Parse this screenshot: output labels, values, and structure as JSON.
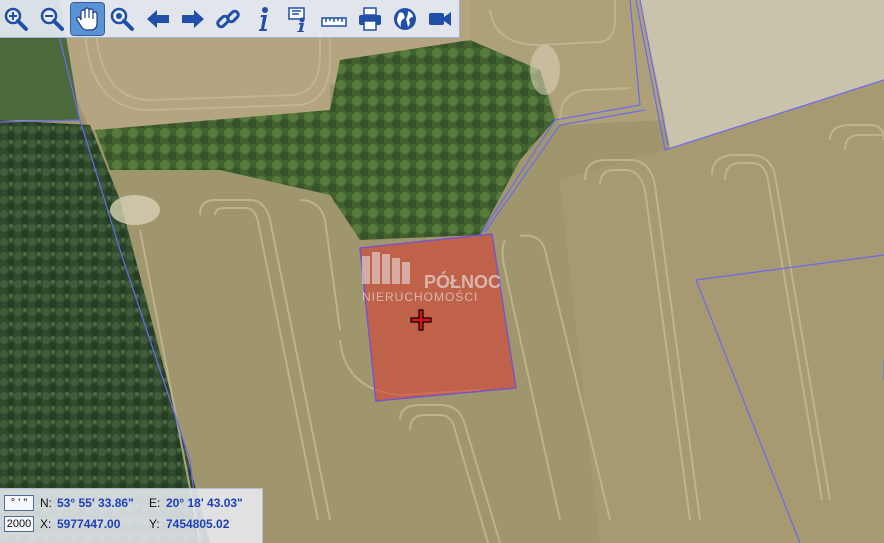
{
  "toolbar": {
    "tools": [
      {
        "name": "zoom-in-icon",
        "active": false
      },
      {
        "name": "zoom-out-icon",
        "active": false
      },
      {
        "name": "pan-hand-icon",
        "active": true
      },
      {
        "name": "zoom-extent-icon",
        "active": false
      },
      {
        "name": "arrow-left-icon",
        "active": false
      },
      {
        "name": "arrow-right-icon",
        "active": false
      },
      {
        "name": "link-icon",
        "active": false
      },
      {
        "name": "info-icon",
        "active": false
      },
      {
        "name": "info-query-icon",
        "active": false
      },
      {
        "name": "ruler-icon",
        "active": false
      },
      {
        "name": "print-icon",
        "active": false
      },
      {
        "name": "globe-icon",
        "active": false
      },
      {
        "name": "video-camera-icon",
        "active": false
      }
    ]
  },
  "watermark": {
    "line1": "PÓŁNOC",
    "line2": "NIERUCHOMOŚCI"
  },
  "coords": {
    "format_button": "° ' \"",
    "scale_button": "2000",
    "n_label": "N:",
    "n_value": "53° 55' 33.86\"",
    "e_label": "E:",
    "e_value": "20° 18' 43.03\"",
    "x_label": "X:",
    "x_value": "5977447.00",
    "y_label": "Y:",
    "y_value": "7454805.02"
  },
  "colors": {
    "parcel_fill": "#d9392b",
    "parcel_border": "#7a55c8",
    "boundary": "#6a6af0",
    "field": "#a39b6f",
    "forest": "#2f4a2c",
    "value_text": "#1d3fb8"
  }
}
